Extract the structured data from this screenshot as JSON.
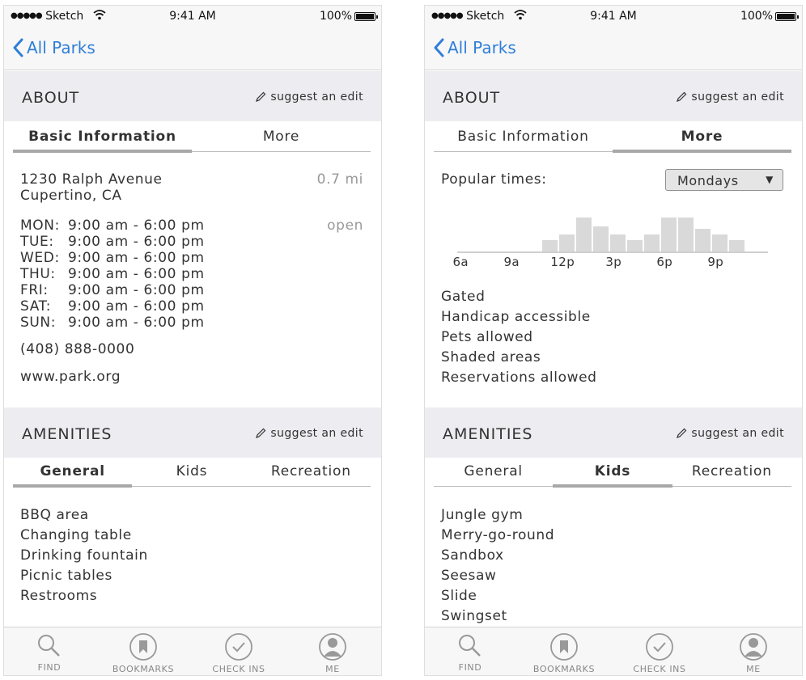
{
  "status_bar": {
    "carrier": "Sketch",
    "time": "9:41 AM",
    "battery": "100%"
  },
  "nav": {
    "back_label": "All Parks"
  },
  "about": {
    "title": "ABOUT",
    "edit_label": "suggest an edit"
  },
  "about_tabs": [
    "Basic Information",
    "More"
  ],
  "basic_info": {
    "address_line1": "1230 Ralph Avenue",
    "address_line2": "Cupertino, CA",
    "distance": "0.7 mi",
    "open_status": "open",
    "hours": [
      {
        "day": "MON:",
        "time": "9:00 am - 6:00 pm"
      },
      {
        "day": "TUE:",
        "time": "9:00 am - 6:00 pm"
      },
      {
        "day": "WED:",
        "time": "9:00 am - 6:00 pm"
      },
      {
        "day": "THU:",
        "time": "9:00 am - 6:00 pm"
      },
      {
        "day": "FRI:",
        "time": "9:00 am - 6:00 pm"
      },
      {
        "day": "SAT:",
        "time": "9:00 am - 6:00 pm"
      },
      {
        "day": "SUN:",
        "time": "9:00 am - 6:00 pm"
      }
    ],
    "phone": "(408) 888-0000",
    "website": "www.park.org"
  },
  "more_info": {
    "popular_times_label": "Popular times:",
    "day_select": "Mondays",
    "features": [
      "Gated",
      "Handicap accessible",
      "Pets allowed",
      "Shaded areas",
      "Reservations allowed"
    ]
  },
  "amenities": {
    "title": "AMENITIES",
    "edit_label": "suggest an edit",
    "tabs": [
      "General",
      "Kids",
      "Recreation"
    ],
    "general": [
      "BBQ area",
      "Changing table",
      "Drinking fountain",
      "Picnic tables",
      "Restrooms"
    ],
    "kids": [
      "Jungle gym",
      "Merry-go-round",
      "Sandbox",
      "Seesaw",
      "Slide",
      "Swingset"
    ]
  },
  "tab_bar": [
    "FIND",
    "BOOKMARKS",
    "CHECK INS",
    "ME"
  ],
  "colors": {
    "accent": "#2f7fd8",
    "section_bg": "#ededf1",
    "bar": "#d9d9d9"
  },
  "chart_data": {
    "type": "bar",
    "title": "Popular times:",
    "tick_labels": [
      "6a",
      "9a",
      "12p",
      "3p",
      "6p",
      "9p"
    ],
    "hours": [
      "6a",
      "7a",
      "8a",
      "9a",
      "10a",
      "11a",
      "12p",
      "1p",
      "2p",
      "3p",
      "4p",
      "5p",
      "6p",
      "7p",
      "8p",
      "9p",
      "10p"
    ],
    "values": [
      0,
      0,
      0,
      0,
      0,
      2,
      3,
      6,
      4.5,
      3,
      2,
      3,
      6,
      6,
      4,
      3,
      2
    ],
    "ylim": [
      0,
      6
    ],
    "grid": false
  }
}
